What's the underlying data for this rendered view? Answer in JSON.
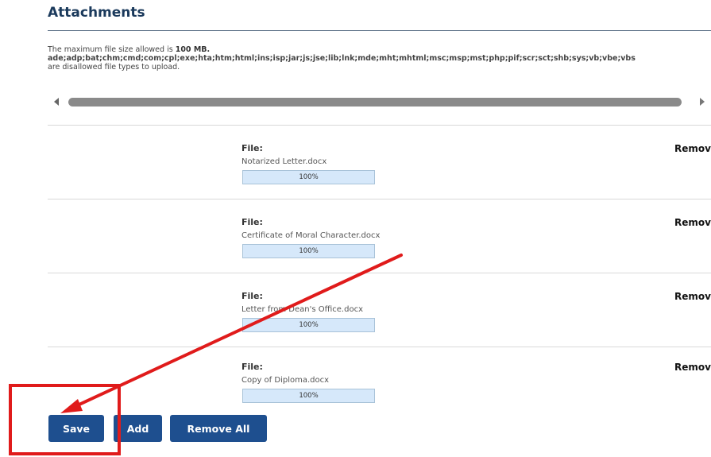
{
  "section": {
    "title": "Attachments"
  },
  "info": {
    "max_size_prefix": "The maximum file size allowed is ",
    "max_size_value": "100 MB.",
    "disallowed_types": "ade;adp;bat;chm;cmd;com;cpl;exe;hta;htm;html;ins;isp;jar;js;jse;lib;lnk;mde;mht;mhtml;msc;msp;mst;php;pif;scr;sct;shb;sys;vb;vbe;vbs",
    "disallowed_suffix": "are disallowed file types to upload."
  },
  "files": [
    {
      "label": "File:",
      "name": "Notarized Letter.docx",
      "progress_text": "100%",
      "progress": 1.0,
      "remove_label": "Remove"
    },
    {
      "label": "File:",
      "name": "Certificate of Moral Character.docx",
      "progress_text": "100%",
      "progress": 1.0,
      "remove_label": "Remove"
    },
    {
      "label": "File:",
      "name": "Letter from Dean's Office.docx",
      "progress_text": "100%",
      "progress": 1.0,
      "remove_label": "Remove"
    },
    {
      "label": "File:",
      "name": "Copy of Diploma.docx",
      "progress_text": "100%",
      "progress": 1.0,
      "remove_label": "Remove"
    }
  ],
  "buttons": {
    "save": "Save",
    "add": "Add",
    "remove_all": "Remove All"
  },
  "colors": {
    "button": "#1e4f8f",
    "annotation": "#e01b1b",
    "progress_fill": "#d6e8fa"
  }
}
